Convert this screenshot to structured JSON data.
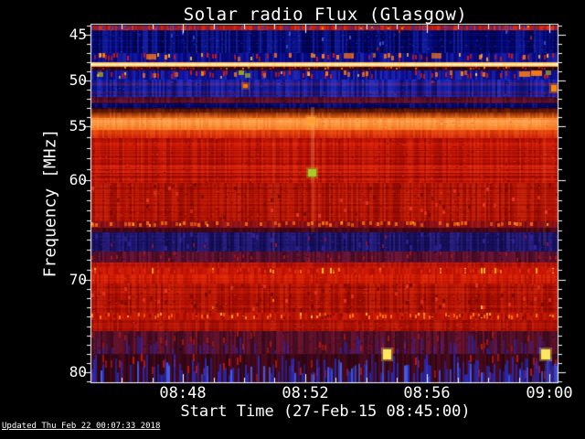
{
  "footer": {
    "text": "Updated Thu Feb 22 00:07:33 2018"
  },
  "colors": {
    "background": "#000000",
    "foreground": "#ffffff"
  },
  "chart_data": {
    "type": "heatmap",
    "title": "Solar radio Flux (Glasgow)",
    "xlabel": "Start Time (27-Feb-15 08:45:00)",
    "ylabel": "Frequency [MHz]",
    "x_start_label": "08:45:00",
    "x_span_min": 15.27,
    "x_minor_step_min": 1,
    "x_ticks": [
      {
        "label": "08:48",
        "min": 3
      },
      {
        "label": "08:52",
        "min": 7
      },
      {
        "label": "08:56",
        "min": 11
      },
      {
        "label": "09:00",
        "min": 15
      }
    ],
    "y_unit": "MHz",
    "y_ticks": [
      45,
      50,
      55,
      60,
      70,
      80
    ],
    "y_minor_step": 1,
    "y_range": [
      44,
      81.1
    ],
    "y_scale_anchors": [
      [
        43.9,
        27
      ],
      [
        45,
        38
      ],
      [
        50,
        88
      ],
      [
        55,
        138
      ],
      [
        60,
        197
      ],
      [
        70,
        306
      ],
      [
        80,
        407
      ],
      [
        81.1,
        418
      ]
    ],
    "noise_seed": 20180222,
    "bands": [
      {
        "name": "top-red-strip",
        "f0": 44.0,
        "f1": 44.55,
        "base": "#c81a00",
        "hi": "#ff5030",
        "lo": "#1a22a0",
        "colAmp": 0.5,
        "pixAmp": 0.3,
        "speckles": [
          {
            "color": "#2236cc",
            "p": 0.3,
            "h": 3,
            "w": 2
          },
          {
            "color": "#ffaa00",
            "p": 0.03,
            "h": 2,
            "w": 2
          }
        ]
      },
      {
        "name": "dark-blue",
        "f0": 44.55,
        "f1": 47.05,
        "base": "#000570",
        "hi": "#2a3ad2",
        "lo": "#000018",
        "colAmp": 0.55,
        "rowAmp": 0.18,
        "pixAmp": 0.3,
        "speckles": [
          {
            "color": "#cc2200",
            "p": 0.03,
            "h": 3,
            "w": 2
          },
          {
            "color": "#4455dd",
            "p": 0.1,
            "h": 4,
            "w": 2
          }
        ]
      },
      {
        "name": "rfi-speckle-upper",
        "f0": 47.05,
        "f1": 47.95,
        "base": "#0a0c92",
        "hi": "#3344cc",
        "lo": "#000030",
        "colAmp": 0.45,
        "speckles": [
          {
            "color": "#dd1804",
            "p": 0.26,
            "h": 5,
            "w": 2
          },
          {
            "color": "#ff7a10",
            "p": 0.13,
            "h": 5,
            "w": 3
          },
          {
            "color": "#ffcc22",
            "p": 0.06,
            "h": 4,
            "w": 2
          },
          {
            "color": "#ff7a10",
            "p": 0.04,
            "h": 6,
            "w": 11
          }
        ]
      },
      {
        "name": "bright-carrier-line",
        "f0": 47.95,
        "f1": 48.55,
        "grad": [
          [
            "#ff8820",
            0
          ],
          [
            "#ffe9a0",
            0.3
          ],
          [
            "#ffffd0",
            0.5
          ],
          [
            "#ffcf60",
            0.78
          ],
          [
            "#ff8820",
            1
          ]
        ],
        "hi": "#ffffff",
        "lo": "#ff7700",
        "colAmp": 0.12,
        "rowAmp": 0.08
      },
      {
        "name": "dark-gap",
        "f0": 48.55,
        "f1": 48.9,
        "base": "#2e0410",
        "hi": "#7a1a10",
        "lo": "#000000",
        "colAmp": 0.35,
        "speckles": [
          {
            "color": "#c02010",
            "p": 0.3,
            "h": 2,
            "w": 2
          },
          {
            "color": "#ff8800",
            "p": 0.06,
            "h": 2,
            "w": 2
          }
        ]
      },
      {
        "name": "rfi-speckle-lower",
        "f0": 48.9,
        "f1": 49.85,
        "base": "#10129c",
        "hi": "#3546d6",
        "lo": "#000040",
        "colAmp": 0.5,
        "speckles": [
          {
            "color": "#d81e04",
            "p": 0.3,
            "h": 5,
            "w": 2
          },
          {
            "color": "#ff7a10",
            "p": 0.12,
            "h": 5,
            "w": 3
          },
          {
            "color": "#9aa020",
            "p": 0.05,
            "h": 5,
            "w": 6
          },
          {
            "color": "#ffcc22",
            "p": 0.05,
            "h": 3,
            "w": 2
          },
          {
            "color": "#ff7a10",
            "p": 0.04,
            "h": 6,
            "w": 12
          }
        ]
      },
      {
        "name": "mid-blue",
        "f0": 49.85,
        "f1": 51.8,
        "base": "#141fae",
        "hi": "#3747de",
        "lo": "#000030",
        "colAmp": 0.5,
        "rowAmp": 0.2,
        "pixAmp": 0.25,
        "hlines": [
          {
            "f": 50.25,
            "color": "#8a1132",
            "h": 2,
            "a": 0.8
          },
          {
            "f": 51.3,
            "color": "#7a1030",
            "h": 2,
            "a": 0.8
          }
        ],
        "speckles": [
          {
            "color": "#c02010",
            "p": 0.02,
            "h": 3,
            "w": 2
          }
        ]
      },
      {
        "name": "maroon-band",
        "f0": 51.8,
        "f1": 52.45,
        "base": "#580e2a",
        "hi": "#8a2044",
        "lo": "#1c0208",
        "colAmp": 0.4,
        "rowAmp": 0.2,
        "pixAmp": 0.25
      },
      {
        "name": "navy-band",
        "f0": 52.45,
        "f1": 53.0,
        "base": "#010463",
        "hi": "#2233c4",
        "lo": "#000016",
        "colAmp": 0.45,
        "rowAmp": 0.15,
        "pixAmp": 0.2
      },
      {
        "name": "ramp-dark",
        "f0": 53.0,
        "f1": 53.55,
        "grad": [
          [
            "#2e030c",
            0
          ],
          [
            "#7c2408",
            1
          ]
        ],
        "hi": "#a83c10",
        "lo": "#160000",
        "colAmp": 0.3,
        "rowAmp": 0.15
      },
      {
        "name": "ramp-orange",
        "f0": 53.55,
        "f1": 54.1,
        "grad": [
          [
            "#7c2408",
            0
          ],
          [
            "#ee6a16",
            1
          ]
        ],
        "hi": "#ff9040",
        "lo": "#8a2800",
        "colAmp": 0.3
      },
      {
        "name": "orange-band",
        "f0": 54.1,
        "f1": 55.35,
        "grad": [
          [
            "#ff8c2c",
            0
          ],
          [
            "#ffa552",
            0.35
          ],
          [
            "#ff7d20",
            1
          ]
        ],
        "hi": "#ffc070",
        "lo": "#e05510",
        "colAmp": 0.25,
        "rowAmp": 0.12,
        "pixAmp": 0.15
      },
      {
        "name": "orange-to-red",
        "f0": 55.35,
        "f1": 56.1,
        "grad": [
          [
            "#f25312",
            0
          ],
          [
            "#d62607",
            1
          ]
        ],
        "hi": "#ff7730",
        "lo": "#9a0e00",
        "colAmp": 0.3,
        "rowAmp": 0.15
      },
      {
        "name": "red-striped",
        "f0": 56.1,
        "f1": 60.3,
        "base": "#c81505",
        "hi": "#ef3d16",
        "lo": "#6e0000",
        "colAmp": 0.4,
        "rowAmp": 0.45,
        "pixAmp": 0.25
      },
      {
        "name": "red-texture",
        "f0": 60.3,
        "f1": 64.15,
        "base": "#b61303",
        "hi": "#e03618",
        "lo": "#600000",
        "colAmp": 0.45,
        "rowAmp": 0.3,
        "pixAmp": 0.3,
        "speckles": [
          {
            "color": "#7a0a00",
            "p": 0.28,
            "h": 4,
            "w": 3
          },
          {
            "color": "#e83820",
            "p": 0.2,
            "h": 4,
            "w": 3
          }
        ]
      },
      {
        "name": "maroon-speckle-row",
        "f0": 64.15,
        "f1": 64.75,
        "base": "#8e1016",
        "hi": "#c03020",
        "lo": "#3a0004",
        "colAmp": 0.35,
        "speckles": [
          {
            "color": "#ff6a10",
            "p": 0.42,
            "h": 4,
            "w": 3
          },
          {
            "color": "#ffb020",
            "p": 0.1,
            "h": 3,
            "w": 2
          }
        ]
      },
      {
        "name": "dark-transition",
        "f0": 64.75,
        "f1": 65.25,
        "base": "#4c061c",
        "hi": "#7e1e30",
        "lo": "#140004",
        "colAmp": 0.35,
        "rowAmp": 0.15
      },
      {
        "name": "navy-texture",
        "f0": 65.25,
        "f1": 67.2,
        "base": "#1c1468",
        "hi": "#3c30a4",
        "lo": "#070228",
        "colAmp": 0.5,
        "rowAmp": 0.15,
        "pixAmp": 0.3,
        "speckles": [
          {
            "color": "#a01226",
            "p": 0.12,
            "h": 4,
            "w": 2
          },
          {
            "color": "#30249a",
            "p": 0.2,
            "h": 5,
            "w": 3
          }
        ]
      },
      {
        "name": "purple-red",
        "f0": 67.2,
        "f1": 68.3,
        "base": "#5c1030",
        "hi": "#8c2040",
        "lo": "#22020c",
        "colAmp": 0.45,
        "pixAmp": 0.3,
        "speckles": [
          {
            "color": "#b81a0a",
            "p": 0.16,
            "h": 4,
            "w": 2
          }
        ]
      },
      {
        "name": "red-row",
        "f0": 68.3,
        "f1": 68.85,
        "base": "#c01405",
        "hi": "#e83818",
        "lo": "#700000",
        "colAmp": 0.35,
        "rowAmp": 0.2
      },
      {
        "name": "yellow-speckle-row",
        "f0": 68.85,
        "f1": 69.45,
        "base": "#c81505",
        "hi": "#e83818",
        "lo": "#7a0400",
        "colAmp": 0.35,
        "speckles": [
          {
            "color": "#ffd820",
            "p": 0.06,
            "h": 6,
            "w": 2
          },
          {
            "color": "#ff9010",
            "p": 0.08,
            "h": 4,
            "w": 2
          },
          {
            "color": "#e03014",
            "p": 0.3,
            "h": 4,
            "w": 2
          }
        ]
      },
      {
        "name": "bright-red",
        "f0": 69.45,
        "f1": 70.35,
        "base": "#d41c04",
        "hi": "#f54018",
        "lo": "#8a0500",
        "colAmp": 0.4,
        "rowAmp": 0.2,
        "pixAmp": 0.2
      },
      {
        "name": "red-texture-2",
        "f0": 70.35,
        "f1": 73.6,
        "base": "#bd1403",
        "hi": "#e03618",
        "lo": "#600000",
        "colAmp": 0.45,
        "rowAmp": 0.3,
        "pixAmp": 0.3,
        "speckles": [
          {
            "color": "#7a0a00",
            "p": 0.26,
            "h": 4,
            "w": 3
          },
          {
            "color": "#e83820",
            "p": 0.2,
            "h": 4,
            "w": 3
          },
          {
            "color": "#ffcc22",
            "p": 0.012,
            "h": 4,
            "w": 2
          },
          {
            "color": "#ff8800",
            "p": 0.02,
            "h": 3,
            "w": 2
          }
        ]
      },
      {
        "name": "orange-speckle-row",
        "f0": 73.6,
        "f1": 74.35,
        "base": "#c41605",
        "hi": "#e03818",
        "lo": "#6e0000",
        "colAmp": 0.35,
        "speckles": [
          {
            "color": "#ff7a10",
            "p": 0.3,
            "h": 4,
            "w": 2
          },
          {
            "color": "#ffc030",
            "p": 0.1,
            "h": 3,
            "w": 2
          },
          {
            "color": "#820a00",
            "p": 0.2,
            "h": 3,
            "w": 2
          }
        ]
      },
      {
        "name": "red-band-2",
        "f0": 74.35,
        "f1": 75.55,
        "base": "#b51203",
        "hi": "#e03818",
        "lo": "#660000",
        "colAmp": 0.4,
        "rowAmp": 0.25,
        "pixAmp": 0.25
      },
      {
        "name": "purple-blue-mix",
        "f0": 75.55,
        "f1": 78.0,
        "base": "#551028",
        "hi": "#8a1838",
        "lo": "#1a0210",
        "colAmp": 0.5,
        "pixAmp": 0.3,
        "streaks": [
          {
            "color": "#2a28c2",
            "p": 0.28,
            "h0": 0.15,
            "h1": 0.85,
            "w": 2,
            "a": 0.65
          }
        ],
        "speckles": [
          {
            "color": "#b01808",
            "p": 0.28,
            "h": 6,
            "w": 2
          }
        ]
      },
      {
        "name": "blue-streak-bottom",
        "f0": 78.0,
        "f1": 81.1,
        "base": "#3a0818",
        "hi": "#6e102a",
        "lo": "#0e0006",
        "colAmp": 0.4,
        "streaks": [
          {
            "color": "#2233dd",
            "p": 0.5,
            "h0": 0.25,
            "h1": 1.0,
            "w": 2,
            "a": 0.8
          },
          {
            "color": "#4466ff",
            "p": 0.12,
            "h0": 0.2,
            "h1": 0.8,
            "w": 2,
            "a": 0.9
          }
        ],
        "speckles": [
          {
            "color": "#c01808",
            "p": 0.32,
            "h": 8,
            "w": 2
          }
        ]
      }
    ],
    "features": [
      {
        "type": "vstreak",
        "min": 7.25,
        "f0": 52.9,
        "f1": 60.3,
        "w": 4,
        "color": "#ffb070",
        "alpha": 0.3
      },
      {
        "type": "vstreak",
        "min": 7.25,
        "f0": 60.3,
        "f1": 65.2,
        "w": 3,
        "color": "#ffb070",
        "alpha": 0.13
      },
      {
        "type": "vstreak",
        "min": 5.95,
        "f0": 55.5,
        "f1": 70.0,
        "w": 3,
        "color": "#ff9a66",
        "alpha": 0.1
      },
      {
        "type": "vstreak",
        "min": 14.82,
        "f0": 54.5,
        "f1": 66.5,
        "w": 3,
        "color": "#ff9a66",
        "alpha": 0.1
      },
      {
        "type": "blob",
        "min": 7.2,
        "f": 53.95,
        "fh": 0.85,
        "w": 9,
        "color": "#ffa030"
      },
      {
        "type": "blob",
        "min": 7.23,
        "f": 59.0,
        "fh": 0.7,
        "w": 9,
        "color": "#a6cc28"
      },
      {
        "type": "blob",
        "min": 9.68,
        "f": 77.55,
        "fh": 1.1,
        "w": 9,
        "color": "#ffe860"
      },
      {
        "type": "blob",
        "min": 14.88,
        "f": 77.55,
        "fh": 1.1,
        "w": 10,
        "color": "#ffe860"
      },
      {
        "type": "blob",
        "min": 5.03,
        "f": 50.35,
        "fh": 0.45,
        "w": 5,
        "color": "#ff7a00"
      },
      {
        "type": "blob",
        "min": 15.16,
        "f": 50.55,
        "fh": 0.65,
        "w": 6,
        "color": "#ff8800"
      }
    ]
  }
}
